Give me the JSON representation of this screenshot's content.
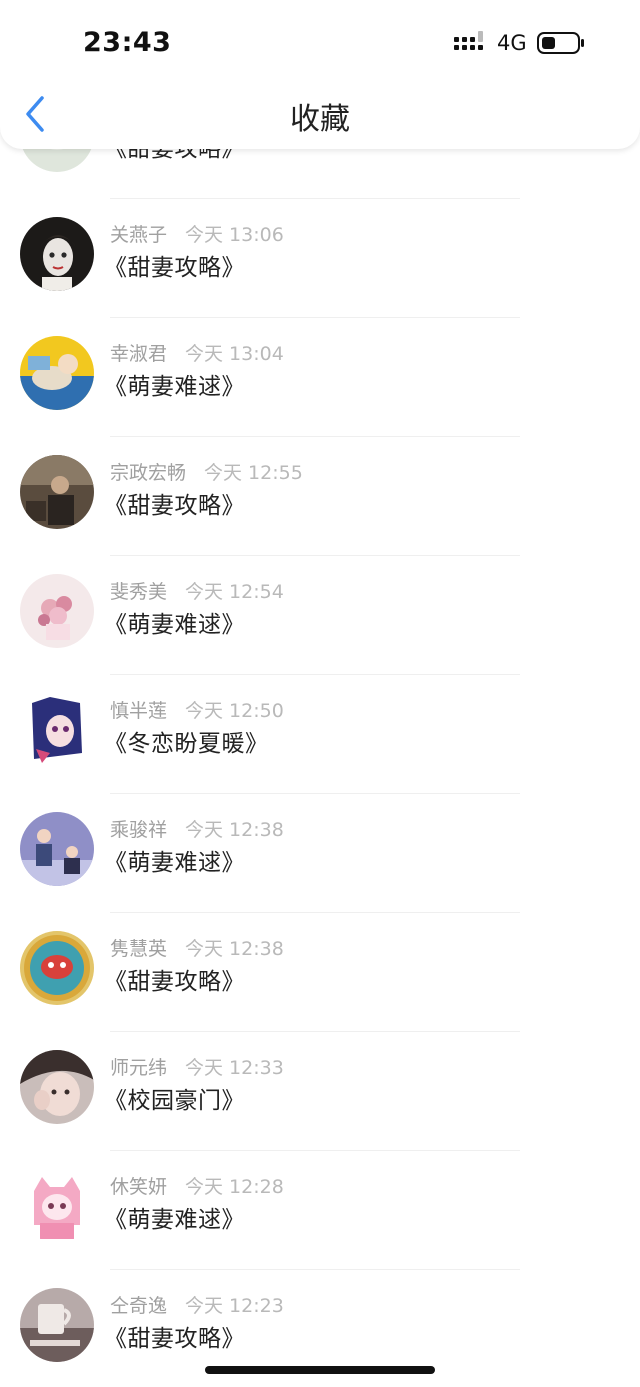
{
  "status_bar": {
    "time": "23:43",
    "network": "4G"
  },
  "header": {
    "title": "收藏",
    "back_icon": "chevron-left-icon",
    "accent_color": "#3d8bf0"
  },
  "favorites": [
    {
      "name": "",
      "time": "",
      "title": "《甜妻攻略》"
    },
    {
      "name": "关燕子",
      "time": "今天 13:06",
      "title": "《甜妻攻略》"
    },
    {
      "name": "幸淑君",
      "time": "今天 13:04",
      "title": "《萌妻难逑》"
    },
    {
      "name": "宗政宏畅",
      "time": "今天 12:55",
      "title": "《甜妻攻略》"
    },
    {
      "name": "斐秀美",
      "time": "今天 12:54",
      "title": "《萌妻难逑》"
    },
    {
      "name": "慎半莲",
      "time": "今天 12:50",
      "title": "《冬恋盼夏暖》"
    },
    {
      "name": "乘骏祥",
      "time": "今天 12:38",
      "title": "《萌妻难逑》"
    },
    {
      "name": "隽慧英",
      "time": "今天 12:38",
      "title": "《甜妻攻略》"
    },
    {
      "name": "师元纬",
      "time": "今天 12:33",
      "title": "《校园豪门》"
    },
    {
      "name": "休笑妍",
      "time": "今天 12:28",
      "title": "《萌妻难逑》"
    },
    {
      "name": "仝奇逸",
      "time": "今天 12:23",
      "title": "《甜妻攻略》"
    }
  ]
}
